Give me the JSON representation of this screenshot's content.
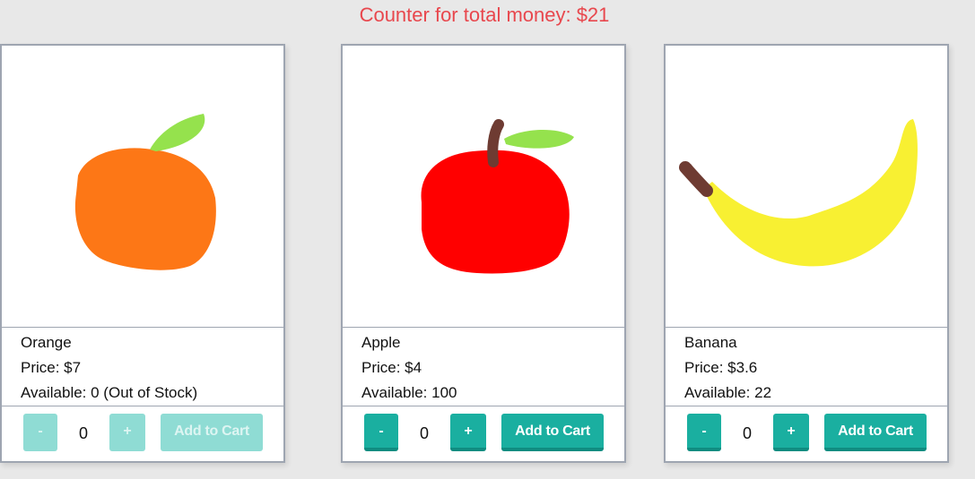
{
  "header": {
    "title": "Counter for total money: $21"
  },
  "products": [
    {
      "name": "Apple",
      "price": "Price: $4",
      "available": "Available: 100",
      "quantity": "0",
      "minus_label": "-",
      "plus_label": "+",
      "add_label": "Add to Cart",
      "image_icon": "apple-icon",
      "enabled": true
    },
    {
      "name": "Banana",
      "price": "Price: $3.6",
      "available": "Available: 22",
      "quantity": "0",
      "minus_label": "-",
      "plus_label": "+",
      "add_label": "Add to Cart",
      "image_icon": "banana-icon",
      "enabled": true
    },
    {
      "name": "Orange",
      "price": "Price: $7",
      "available": "Available: 0 (Out of Stock)",
      "quantity": "0",
      "minus_label": "-",
      "plus_label": "+",
      "add_label": "Add to Cart",
      "image_icon": "orange-icon",
      "enabled": false
    }
  ],
  "colors": {
    "header_text": "#e8474d",
    "button": "#1aafa0",
    "button_disabled": "#8fdcd4",
    "card_border": "#9ea5b1",
    "apple": "#ff0000",
    "banana": "#f8f032",
    "orange": "#fd7716",
    "leaf": "#95e24d",
    "stem": "#6e3b32"
  }
}
